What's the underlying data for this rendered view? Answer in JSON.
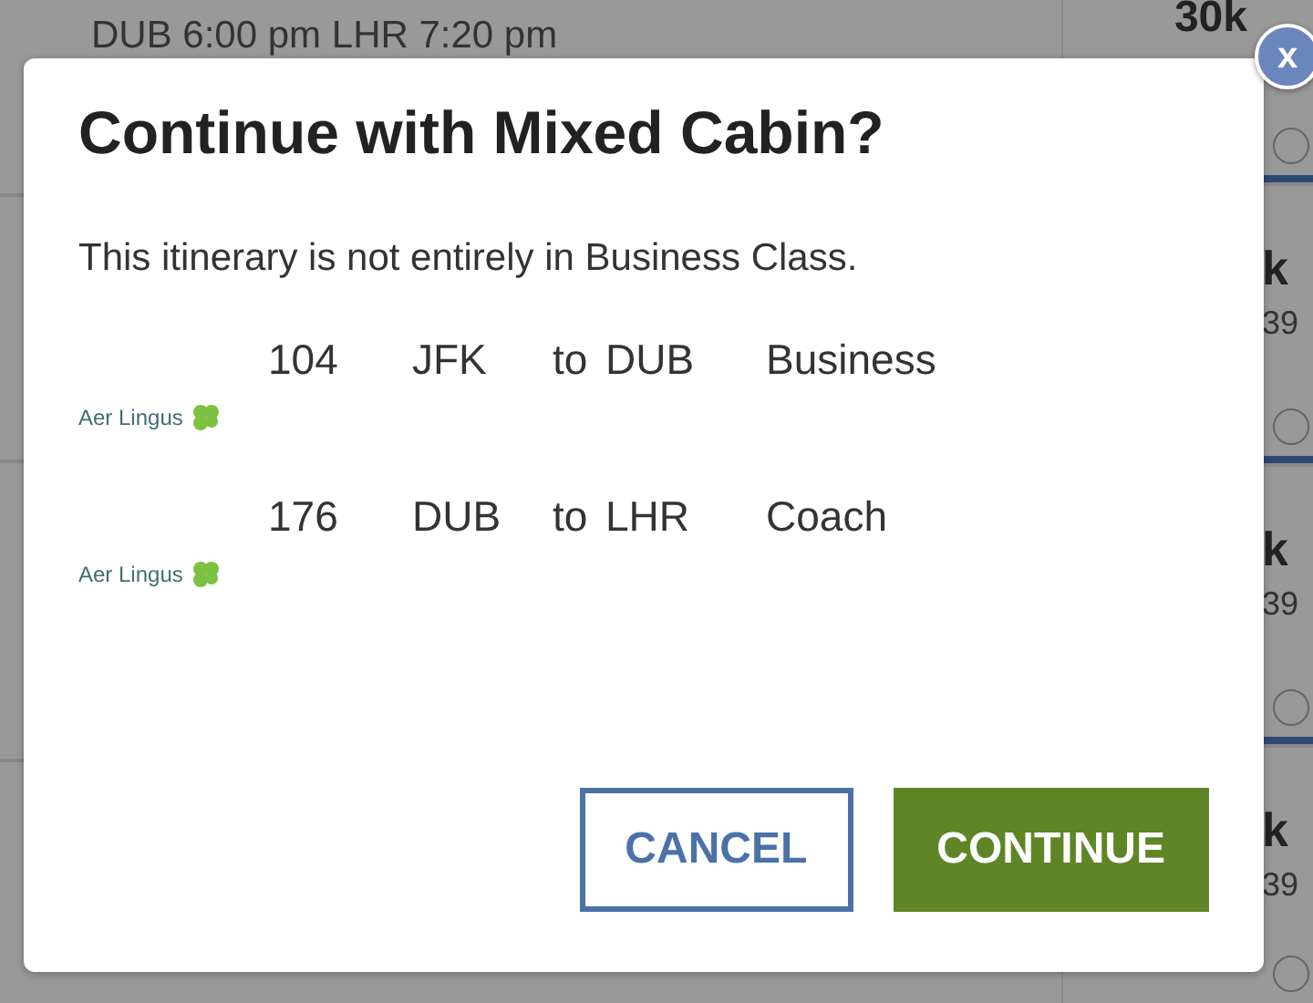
{
  "background": {
    "flight_times": "DUB  6:00 pm  LHR  7:20 pm",
    "top_price": "30k",
    "top_selected": false,
    "fares": [
      {
        "unit": "k",
        "amount": "39",
        "selected": false
      },
      {
        "unit": "k",
        "amount": "39",
        "selected": false
      },
      {
        "unit": "k",
        "amount": "39",
        "selected": false
      }
    ]
  },
  "dialog": {
    "close_label": "x",
    "title": "Continue with Mixed Cabin?",
    "message": "This itinerary is not entirely in Business Class.",
    "segments": [
      {
        "flight": "104",
        "origin": "JFK",
        "connector": "to",
        "destination": "DUB",
        "cabin": "Business",
        "airline": "Aer Lingus"
      },
      {
        "flight": "176",
        "origin": "DUB",
        "connector": "to",
        "destination": "LHR",
        "cabin": "Coach",
        "airline": "Aer Lingus"
      }
    ],
    "buttons": [
      {
        "label": "CANCEL",
        "kind": "secondary"
      },
      {
        "label": "CONTINUE",
        "kind": "primary"
      }
    ]
  }
}
